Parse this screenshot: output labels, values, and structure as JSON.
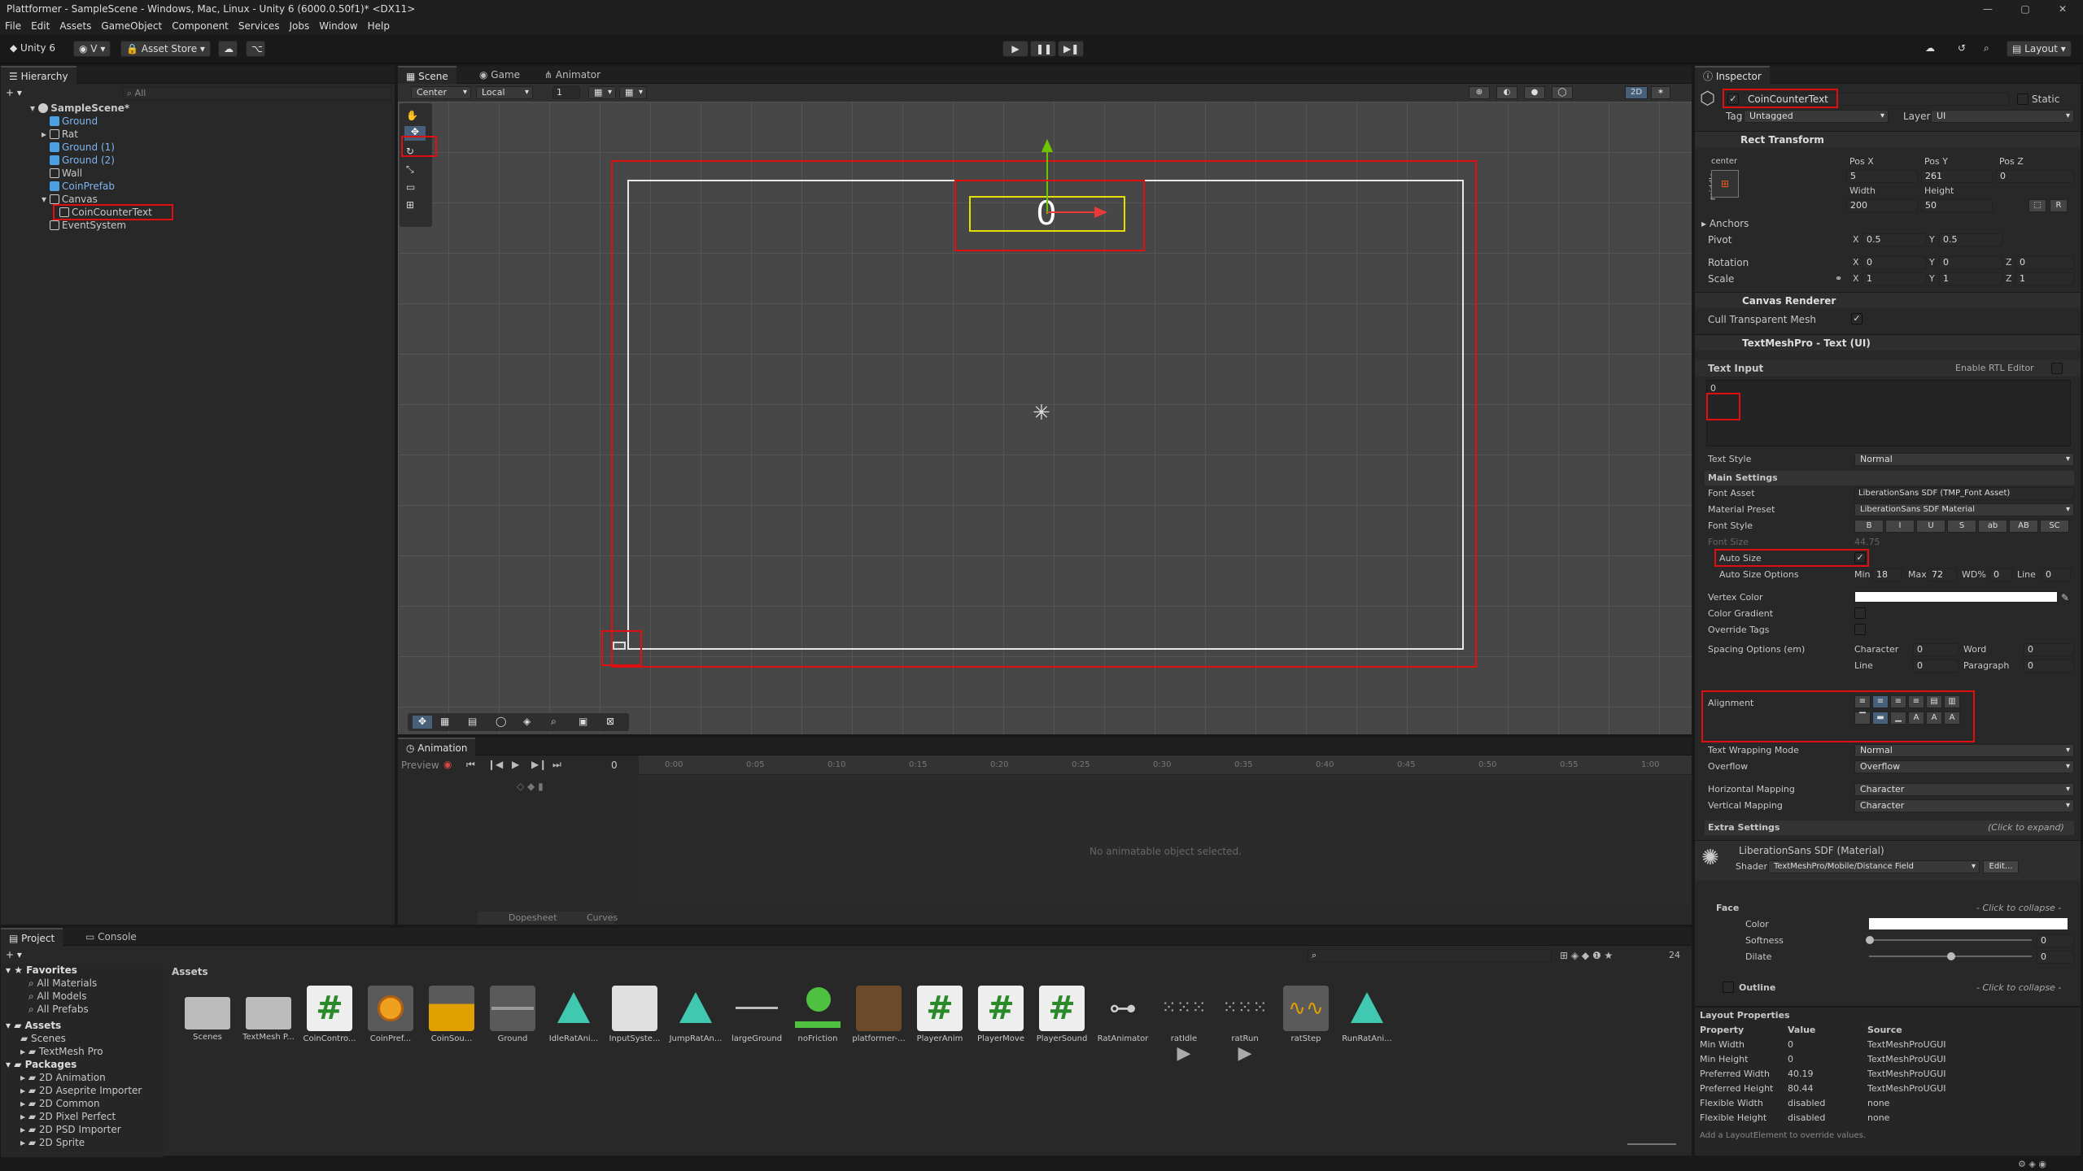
{
  "window": {
    "title": "Plattformer - SampleScene - Windows, Mac, Linux - Unity 6 (6000.0.50f1)* <DX11>"
  },
  "menu": [
    "File",
    "Edit",
    "Assets",
    "GameObject",
    "Component",
    "Services",
    "Jobs",
    "Window",
    "Help"
  ],
  "toolbar": {
    "account": "Unity 6",
    "user": "V",
    "asset_store": "Asset Store",
    "layout": "Layout"
  },
  "hierarchy": {
    "tab": "Hierarchy",
    "search_placeholder": "All",
    "items": [
      {
        "label": "SampleScene*"
      },
      {
        "label": "Ground"
      },
      {
        "label": "Rat"
      },
      {
        "label": "Ground (1)"
      },
      {
        "label": "Ground (2)"
      },
      {
        "label": "Wall"
      },
      {
        "label": "CoinPrefab"
      },
      {
        "label": "Canvas"
      },
      {
        "label": "CoinCounterText"
      },
      {
        "label": "EventSystem"
      }
    ]
  },
  "scene": {
    "tabs": [
      "Scene",
      "Game",
      "Animator"
    ],
    "pivot": "Center",
    "space": "Local",
    "snap": "1",
    "mode2d": "2D",
    "coin_text": "0"
  },
  "animation": {
    "tab": "Animation",
    "preview": "Preview",
    "frame": "0",
    "empty": "No animatable object selected.",
    "dopesheet": "Dopesheet",
    "curves": "Curves",
    "ticks": [
      "0:00",
      "0:05",
      "0:10",
      "0:15",
      "0:20",
      "0:25",
      "0:30",
      "0:35",
      "0:40",
      "0:45",
      "0:50",
      "0:55",
      "1:00"
    ]
  },
  "project": {
    "tabs": [
      "Project",
      "Console"
    ],
    "badge": "24",
    "favorites": {
      "title": "Favorites",
      "items": [
        "All Materials",
        "All Models",
        "All Prefabs"
      ]
    },
    "assets_tree": {
      "title": "Assets",
      "items": [
        "Scenes",
        "TextMesh Pro"
      ]
    },
    "packages": {
      "title": "Packages",
      "items": [
        "2D Animation",
        "2D Aseprite Importer",
        "2D Common",
        "2D Pixel Perfect",
        "2D PSD Importer",
        "2D Sprite"
      ]
    },
    "breadcrumb": "Assets",
    "assets": [
      "Scenes",
      "TextMesh P...",
      "CoinContro...",
      "CoinPref...",
      "CoinSou...",
      "Ground",
      "IdleRatAni...",
      "InputSyste...",
      "JumpRatAn...",
      "largeGround",
      "noFriction",
      "platformer-...",
      "PlayerAnim",
      "PlayerMove",
      "PlayerSound",
      "RatAnimator",
      "ratIdle",
      "ratRun",
      "ratStep",
      "RunRatAni..."
    ]
  },
  "inspector": {
    "tab": "Inspector",
    "object_name": "CoinCounterText",
    "static": "Static",
    "tag_label": "Tag",
    "tag": "Untagged",
    "layer_label": "Layer",
    "layer": "UI",
    "rect": {
      "title": "Rect Transform",
      "anchor": "center",
      "side": "middle",
      "posx_l": "Pos X",
      "posy_l": "Pos Y",
      "posz_l": "Pos Z",
      "posx": "5",
      "posy": "261",
      "posz": "0",
      "w_l": "Width",
      "h_l": "Height",
      "w": "200",
      "h": "50",
      "anchors": "Anchors",
      "pivot": "Pivot",
      "pivx": "0.5",
      "pivy": "0.5",
      "rotation": "Rotation",
      "rx": "0",
      "ry": "0",
      "rz": "0",
      "scale": "Scale",
      "sx": "1",
      "sy": "1",
      "sz": "1"
    },
    "canvas_renderer": {
      "title": "Canvas Renderer",
      "cull": "Cull Transparent Mesh"
    },
    "tmp": {
      "title": "TextMeshPro - Text (UI)",
      "text_input": "Text Input",
      "rtl": "Enable RTL Editor",
      "text": "0",
      "text_style_l": "Text Style",
      "text_style": "Normal",
      "main": "Main Settings",
      "font_asset_l": "Font Asset",
      "font_asset": "LiberationSans SDF (TMP_Font Asset)",
      "material_l": "Material Preset",
      "material": "LiberationSans SDF Material",
      "font_style_l": "Font Style",
      "font_style_btns": [
        "B",
        "I",
        "U",
        "S",
        "ab",
        "AB",
        "SC"
      ],
      "font_size_l": "Font Size",
      "font_size": "44.75",
      "auto_size": "Auto Size",
      "auto_opts": "Auto Size Options",
      "min_l": "Min",
      "min": "18",
      "max_l": "Max",
      "max": "72",
      "wd_l": "WD%",
      "wd": "0",
      "line_l": "Line",
      "line": "0",
      "vertex": "Vertex Color",
      "gradient": "Color Gradient",
      "override": "Override Tags",
      "spacing": "Spacing Options (em)",
      "char_l": "Character",
      "char": "0",
      "word_l": "Word",
      "word": "0",
      "line2_l": "Line",
      "line2": "0",
      "para_l": "Paragraph",
      "para": "0",
      "alignment": "Alignment",
      "wrap_l": "Text Wrapping Mode",
      "wrap": "Normal",
      "overflow_l": "Overflow",
      "overflow": "Overflow",
      "hmap_l": "Horizontal Mapping",
      "hmap": "Character",
      "vmap_l": "Vertical Mapping",
      "vmap": "Character",
      "extra": "Extra Settings",
      "expand": "(Click to expand)"
    },
    "material": {
      "title": "LiberationSans SDF (Material)",
      "shader_l": "Shader",
      "shader": "TextMeshPro/Mobile/Distance Field",
      "edit": "Edit...",
      "face": "Face",
      "collapse": "- Click to collapse -",
      "color": "Color",
      "softness": "Softness",
      "softness_v": "0",
      "dilate": "Dilate",
      "dilate_v": "0",
      "outline": "Outline",
      "outline_collapse": "- Click to collapse -"
    },
    "layout": {
      "title": "Layout Properties",
      "cols": [
        "Property",
        "Value",
        "Source"
      ],
      "rows": [
        [
          "Min Width",
          "0",
          "TextMeshProUGUI"
        ],
        [
          "Min Height",
          "0",
          "TextMeshProUGUI"
        ],
        [
          "Preferred Width",
          "40.19",
          "TextMeshProUGUI"
        ],
        [
          "Preferred Height",
          "80.44",
          "TextMeshProUGUI"
        ],
        [
          "Flexible Width",
          "disabled",
          "none"
        ],
        [
          "Flexible Height",
          "disabled",
          "none"
        ]
      ],
      "footer": "Add a LayoutElement to override values."
    }
  }
}
